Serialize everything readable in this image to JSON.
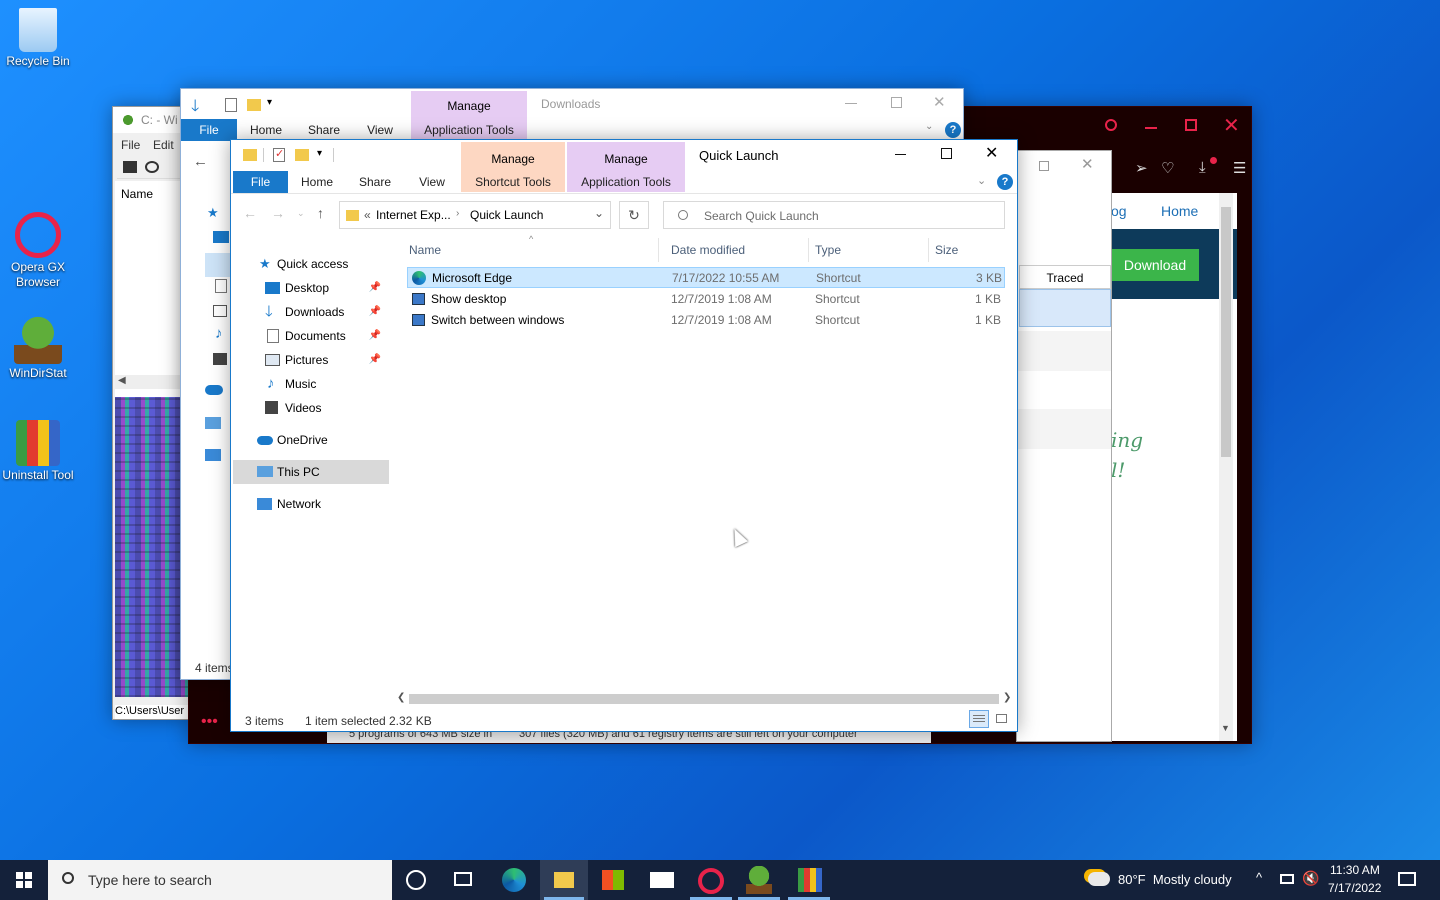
{
  "desktop": {
    "icons": [
      {
        "label": "Recycle Bin"
      },
      {
        "label": "Opera GX Browser"
      },
      {
        "label": "WinDirStat"
      },
      {
        "label": "Uninstall Tool"
      }
    ]
  },
  "windirstat": {
    "title": "C: - Wi",
    "menu": [
      "File",
      "Edit"
    ],
    "col_name": "Name",
    "status_path": "C:\\Users\\User"
  },
  "downloads_window": {
    "title": "Downloads",
    "context_tab": "Manage",
    "context_sub": "Application Tools",
    "tabs": [
      "File",
      "Home",
      "Share",
      "View"
    ],
    "status": "4 items"
  },
  "uninstall_window": {
    "nav_partial": "og",
    "nav_home": "Home",
    "download_btn": "Download",
    "col_traced": "Traced",
    "promo_text": "ing\nl!",
    "status_text": "5 programs of 643 MB size in",
    "status_text2": "307 files (320 MB) and 61 registry items are still left on your computer"
  },
  "explorer": {
    "title": "Quick Launch",
    "context_tabs": [
      {
        "top": "Manage",
        "bottom": "Shortcut Tools",
        "color": "#fdd7c2"
      },
      {
        "top": "Manage",
        "bottom": "Application Tools",
        "color": "#e6ccf3"
      }
    ],
    "tabs": [
      "File",
      "Home",
      "Share",
      "View"
    ],
    "breadcrumb_prefix": "«",
    "breadcrumb": [
      "Internet Exp...",
      "Quick Launch"
    ],
    "search_placeholder": "Search Quick Launch",
    "columns": [
      "Name",
      "Date modified",
      "Type",
      "Size"
    ],
    "files": [
      {
        "name": "Microsoft Edge",
        "date": "7/17/2022 10:55 AM",
        "type": "Shortcut",
        "size": "3 KB",
        "selected": true
      },
      {
        "name": "Show desktop",
        "date": "12/7/2019 1:08 AM",
        "type": "Shortcut",
        "size": "1 KB",
        "selected": false
      },
      {
        "name": "Switch between windows",
        "date": "12/7/2019 1:08 AM",
        "type": "Shortcut",
        "size": "1 KB",
        "selected": false
      }
    ],
    "nav": {
      "quick_access": "Quick access",
      "pinned": [
        "Desktop",
        "Downloads",
        "Documents",
        "Pictures"
      ],
      "unpinned": [
        "Music",
        "Videos"
      ],
      "onedrive": "OneDrive",
      "this_pc": "This PC",
      "network": "Network"
    },
    "status": {
      "count": "3 items",
      "selected": "1 item selected",
      "size": "2.32 KB"
    }
  },
  "taskbar": {
    "search_placeholder": "Type here to search",
    "weather": "80°F  Mostly cloudy",
    "time": "11:30 AM",
    "date": "7/17/2022"
  },
  "colors": {
    "accent": "#1979ca",
    "selection": "#cce8ff",
    "uninstall_green": "#3bb54a",
    "uninstall_dark": "#0d3a5a"
  }
}
